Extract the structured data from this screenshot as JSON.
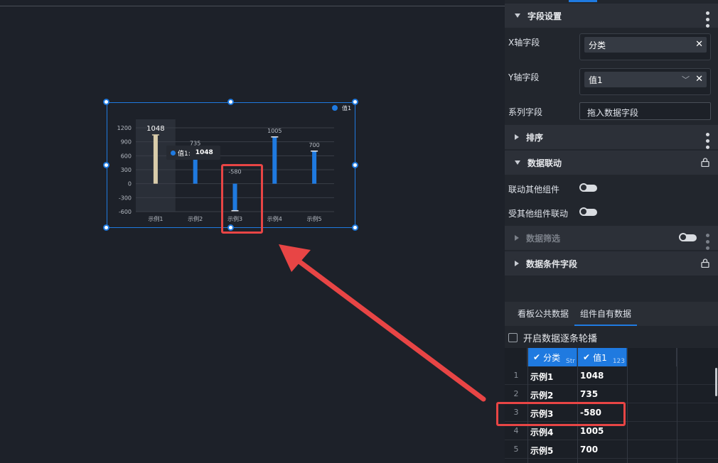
{
  "chart": {
    "legend_label": "值1",
    "tooltip_label": "值1:",
    "tooltip_value": "1048"
  },
  "chart_data": {
    "type": "bar",
    "categories": [
      "示例1",
      "示例2",
      "示例3",
      "示例4",
      "示例5"
    ],
    "series": [
      {
        "name": "值1",
        "values": [
          1048,
          735,
          -580,
          1005,
          700
        ]
      }
    ],
    "data_labels": [
      "1048",
      "735",
      "-580",
      "1005",
      "700"
    ],
    "y_ticks": [
      "1200",
      "900",
      "600",
      "300",
      "0",
      "-300",
      "-600"
    ],
    "ylim": [
      -600,
      1200
    ],
    "grid": true,
    "legend_position": "top-right",
    "colors": {
      "bar": "#1f7ae0",
      "highlighted_bar": "#d9ccaa"
    },
    "highlighted_index": 0
  },
  "panel": {
    "field_settings": {
      "title": "字段设置"
    },
    "x_field": {
      "label": "X轴字段",
      "value": "分类"
    },
    "y_field": {
      "label": "Y轴字段",
      "value": "值1"
    },
    "series_field": {
      "label": "系列字段",
      "placeholder": "拖入数据字段"
    },
    "sort": {
      "title": "排序"
    },
    "linkage": {
      "title": "数据联动",
      "link_others": "联动其他组件",
      "linked_by_others": "受其他组件联动"
    },
    "filter": {
      "title": "数据筛选"
    },
    "condition": {
      "title": "数据条件字段"
    },
    "tabs": {
      "public": "看板公共数据",
      "own": "组件自有数据"
    },
    "carousel_label": "开启数据逐条轮播",
    "grid": {
      "columns": [
        {
          "name": "分类",
          "type": "Str"
        },
        {
          "name": "值1",
          "type": "123"
        }
      ],
      "rows": [
        {
          "n": "1",
          "cat": "示例1",
          "val": "1048"
        },
        {
          "n": "2",
          "cat": "示例2",
          "val": "735"
        },
        {
          "n": "3",
          "cat": "示例3",
          "val": "-580"
        },
        {
          "n": "4",
          "cat": "示例4",
          "val": "1005"
        },
        {
          "n": "5",
          "cat": "示例5",
          "val": "700"
        }
      ]
    }
  },
  "colors": {
    "accent": "#1f7ae0",
    "highlight": "#e84545"
  }
}
